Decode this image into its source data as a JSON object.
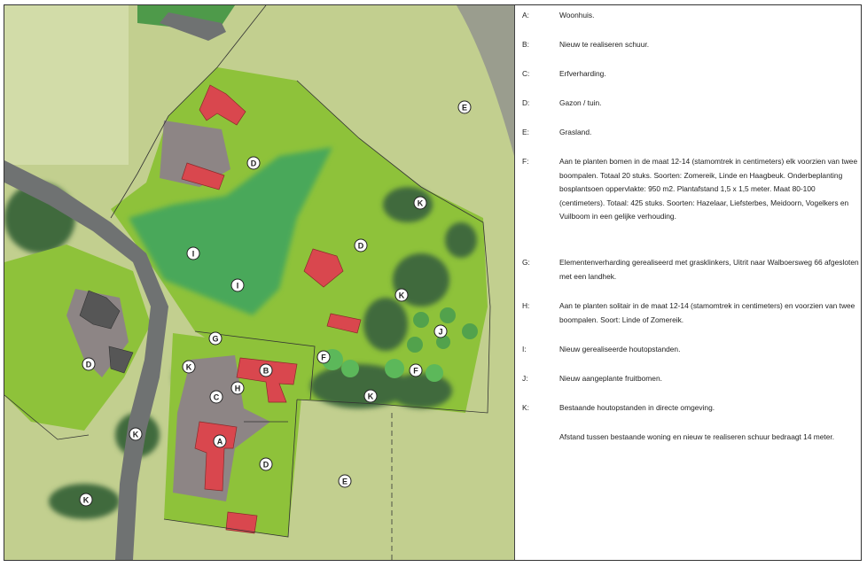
{
  "map": {
    "markers": {
      "A": "A",
      "B": "B",
      "C": "C",
      "D1": "D",
      "D2": "D",
      "D3": "D",
      "D4": "D",
      "E1": "E",
      "E2": "E",
      "F1": "F",
      "F2": "F",
      "G": "G",
      "H": "H",
      "I1": "I",
      "I2": "I",
      "J": "J",
      "K1": "K",
      "K2": "K",
      "K3": "K",
      "K4": "K",
      "K5": "K",
      "K6": "K"
    }
  },
  "legend": {
    "items": [
      {
        "key": "A:",
        "text": "Woonhuis."
      },
      {
        "key": "B:",
        "text": "Nieuw te realiseren schuur."
      },
      {
        "key": "C:",
        "text": "Erfverharding."
      },
      {
        "key": "D:",
        "text": "Gazon / tuin."
      },
      {
        "key": "E:",
        "text": "Grasland."
      },
      {
        "key": "F:",
        "text": "Aan te planten bomen in de maat 12-14 (stamomtrek in centimeters) elk voorzien van twee boompalen. Totaal 20 stuks. Soorten: Zomereik, Linde en Haagbeuk. Onderbeplanting bosplantsoen oppervlakte: 950 m2. Plantafstand 1,5 x 1,5 meter. Maat 80-100 (centimeters). Totaal: 425 stuks. Soorten: Hazelaar, Liefsterbes, Meidoorn, Vogelkers en Vuilboom in een gelijke verhouding."
      },
      {
        "key": "G:",
        "text": "Elementenverharding gerealiseerd met grasklinkers, Uitrit naar Walboersweg 66 afgesloten met een landhek."
      },
      {
        "key": "H:",
        "text": "Aan te planten solitair in de maat 12-14 (stamomtrek in centimeters) en voorzien van twee boompalen. Soort: Linde of Zomereik."
      },
      {
        "key": "I:",
        "text": "Nieuw gerealiseerde houtopstanden."
      },
      {
        "key": "J:",
        "text": "Nieuw aangeplante fruitbomen."
      },
      {
        "key": "K:",
        "text": "Bestaande houtopstanden in directe omgeving."
      },
      {
        "key": "",
        "text": "Afstand tussen bestaande woning en nieuw te realiseren schuur bedraagt 14 meter."
      }
    ]
  },
  "colors": {
    "grassland": "#c5d192",
    "garden": "#8ec23a",
    "trees": "#3f9a48",
    "existing_trees": "#3a6e3a",
    "paving": "#8d8585",
    "building": "#d9474e",
    "road": "#6f7272"
  }
}
